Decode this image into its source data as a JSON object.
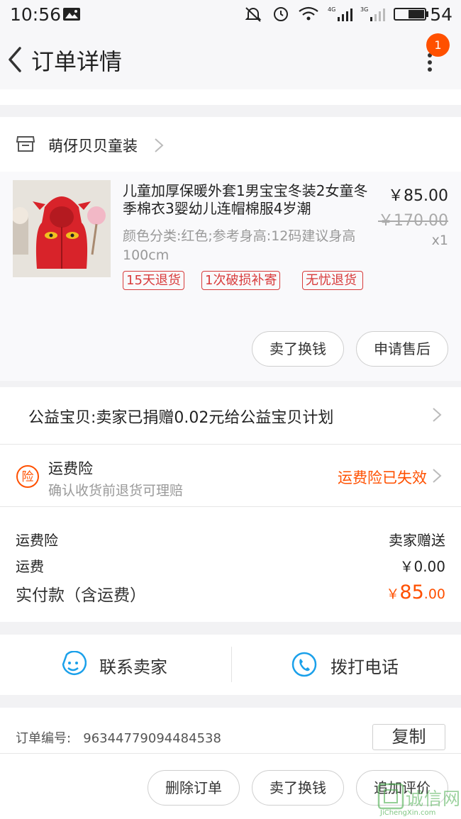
{
  "status_bar": {
    "time": "10:56",
    "battery": "54"
  },
  "header": {
    "title": "订单详情",
    "badge_count": "1"
  },
  "shop": {
    "name": "萌伢贝贝童装"
  },
  "product": {
    "title": "儿童加厚保暖外套1男宝宝冬装2女童冬季棉衣3婴幼儿连帽棉服4岁潮",
    "spec": "颜色分类:红色;参考身高:12码建议身高100cm",
    "price": "￥85.00",
    "original_price": "￥170.00",
    "quantity": "x1",
    "tags": [
      "15天退货",
      "1次破损补寄",
      "无忧退货"
    ]
  },
  "item_actions": {
    "sell_label": "卖了换钱",
    "after_sale_label": "申请售后"
  },
  "charity": {
    "text": "公益宝贝:卖家已捐赠0.02元给公益宝贝计划"
  },
  "insurance": {
    "icon_char": "险",
    "title": "运费险",
    "subtitle": "确认收货前退货可理赔",
    "status": "运费险已失效"
  },
  "fees": [
    {
      "label": "运费险",
      "value": "卖家赠送"
    },
    {
      "label": "运费",
      "value": "￥0.00"
    }
  ],
  "total": {
    "label": "实付款（含运费）",
    "currency": "￥",
    "integer": "85",
    "decimal": ".00"
  },
  "contact": {
    "seller_label": "联系卖家",
    "call_label": "拨打电话"
  },
  "order": {
    "number_label": "订单编号:",
    "number": "96344779094484538",
    "copy_label": "复制"
  },
  "bottom_actions": {
    "delete_label": "删除订单",
    "sell_label": "卖了换钱",
    "review_label": "追加评价"
  },
  "watermark": {
    "text": "诚信网",
    "url": "JiChengXin.com"
  },
  "colors": {
    "accent": "#ff5000",
    "tag_red": "#d83b3b",
    "contact_blue": "#1aa0ea",
    "page_bg": "#f2f2f4"
  }
}
